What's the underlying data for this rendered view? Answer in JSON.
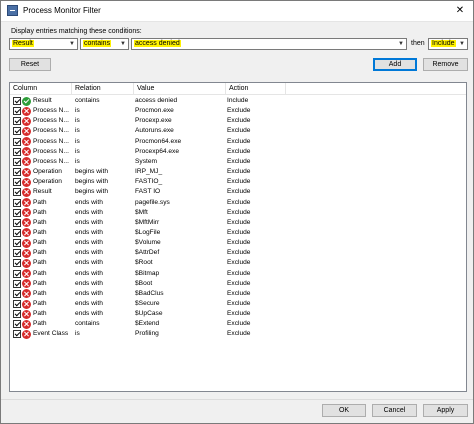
{
  "window": {
    "title": "Process Monitor Filter",
    "close_glyph": "✕"
  },
  "conditions": {
    "label": "Display entries matching these conditions:",
    "column_value": "Result",
    "relation_value": "contains",
    "value_text": "access denied",
    "then_label": "then",
    "action_value": "Include"
  },
  "buttons": {
    "reset": "Reset",
    "add": "Add",
    "remove": "Remove",
    "ok": "OK",
    "cancel": "Cancel",
    "apply": "Apply"
  },
  "table": {
    "headers": [
      "Column",
      "Relation",
      "Value",
      "Action"
    ],
    "rows": [
      {
        "column": "Result",
        "relation": "contains",
        "value": "access denied",
        "action": "Include",
        "icon": "include"
      },
      {
        "column": "Process N...",
        "relation": "is",
        "value": "Procmon.exe",
        "action": "Exclude",
        "icon": "exclude"
      },
      {
        "column": "Process N...",
        "relation": "is",
        "value": "Procexp.exe",
        "action": "Exclude",
        "icon": "exclude"
      },
      {
        "column": "Process N...",
        "relation": "is",
        "value": "Autoruns.exe",
        "action": "Exclude",
        "icon": "exclude"
      },
      {
        "column": "Process N...",
        "relation": "is",
        "value": "Procmon64.exe",
        "action": "Exclude",
        "icon": "exclude"
      },
      {
        "column": "Process N...",
        "relation": "is",
        "value": "Procexp64.exe",
        "action": "Exclude",
        "icon": "exclude"
      },
      {
        "column": "Process N...",
        "relation": "is",
        "value": "System",
        "action": "Exclude",
        "icon": "exclude"
      },
      {
        "column": "Operation",
        "relation": "begins with",
        "value": "IRP_MJ_",
        "action": "Exclude",
        "icon": "exclude"
      },
      {
        "column": "Operation",
        "relation": "begins with",
        "value": "FASTIO_",
        "action": "Exclude",
        "icon": "exclude"
      },
      {
        "column": "Result",
        "relation": "begins with",
        "value": "FAST IO",
        "action": "Exclude",
        "icon": "exclude"
      },
      {
        "column": "Path",
        "relation": "ends with",
        "value": "pagefile.sys",
        "action": "Exclude",
        "icon": "exclude"
      },
      {
        "column": "Path",
        "relation": "ends with",
        "value": "$Mft",
        "action": "Exclude",
        "icon": "exclude"
      },
      {
        "column": "Path",
        "relation": "ends with",
        "value": "$MftMirr",
        "action": "Exclude",
        "icon": "exclude"
      },
      {
        "column": "Path",
        "relation": "ends with",
        "value": "$LogFile",
        "action": "Exclude",
        "icon": "exclude"
      },
      {
        "column": "Path",
        "relation": "ends with",
        "value": "$Volume",
        "action": "Exclude",
        "icon": "exclude"
      },
      {
        "column": "Path",
        "relation": "ends with",
        "value": "$AttrDef",
        "action": "Exclude",
        "icon": "exclude"
      },
      {
        "column": "Path",
        "relation": "ends with",
        "value": "$Root",
        "action": "Exclude",
        "icon": "exclude"
      },
      {
        "column": "Path",
        "relation": "ends with",
        "value": "$Bitmap",
        "action": "Exclude",
        "icon": "exclude"
      },
      {
        "column": "Path",
        "relation": "ends with",
        "value": "$Boot",
        "action": "Exclude",
        "icon": "exclude"
      },
      {
        "column": "Path",
        "relation": "ends with",
        "value": "$BadClus",
        "action": "Exclude",
        "icon": "exclude"
      },
      {
        "column": "Path",
        "relation": "ends with",
        "value": "$Secure",
        "action": "Exclude",
        "icon": "exclude"
      },
      {
        "column": "Path",
        "relation": "ends with",
        "value": "$UpCase",
        "action": "Exclude",
        "icon": "exclude"
      },
      {
        "column": "Path",
        "relation": "contains",
        "value": "$Extend",
        "action": "Exclude",
        "icon": "exclude"
      },
      {
        "column": "Event Class",
        "relation": "is",
        "value": "Profiling",
        "action": "Exclude",
        "icon": "exclude"
      }
    ]
  },
  "colors": {
    "highlight": "#fff200",
    "include": "#2e9e3a",
    "exclude": "#d62c2c",
    "default_button_border": "#0078d7"
  }
}
